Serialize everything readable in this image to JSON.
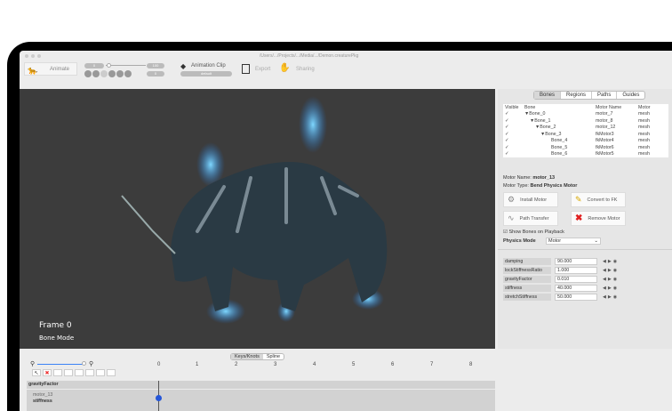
{
  "window": {
    "title": "/Users/.../Projects/.../Media/.../Demon.creaturePkg"
  },
  "toolbar": {
    "mode_label": "Animate",
    "range_start": "0",
    "range_end": "100",
    "frame": "0",
    "clip_label": "Animation Clip",
    "clip_value": "default",
    "export_label": "Export",
    "sharing_label": "Sharing"
  },
  "viewport": {
    "frame_label": "Frame 0",
    "mode_label": "Bone Mode"
  },
  "panel": {
    "tabs": [
      "Bones",
      "Regions",
      "Paths",
      "Guides"
    ],
    "columns": [
      "Visible",
      "Bone",
      "Motor Name",
      "Motor"
    ],
    "rows": [
      [
        "✓",
        "▼Bone_0",
        "motor_7",
        "mesh"
      ],
      [
        "✓",
        "▼Bone_1",
        "motor_8",
        "mesh"
      ],
      [
        "✓",
        "▼Bone_2",
        "motor_12",
        "mesh"
      ],
      [
        "✓",
        "▼Bone_3",
        "fkMotor3",
        "mesh"
      ],
      [
        "✓",
        "Bone_4",
        "fkMotor4",
        "mesh"
      ],
      [
        "✓",
        "Bone_5",
        "fkMotor6",
        "mesh"
      ],
      [
        "✓",
        "Bone_6",
        "fkMotor5",
        "mesh"
      ]
    ],
    "motor_name_label": "Motor Name:",
    "motor_name": "motor_13",
    "motor_type_label": "Motor Type:",
    "motor_type": "Bend Physics Motor",
    "buttons": {
      "install": "Install Motor",
      "convert": "Convert to FK",
      "path": "Path Transfer",
      "remove": "Remove Motor"
    },
    "show_bones": "Show Bones on Playback",
    "physics_mode_label": "Physics Mode",
    "physics_mode": "Motor",
    "props": [
      {
        "name": "damping",
        "value": "90.000"
      },
      {
        "name": "lockStiffnessRatio",
        "value": "1.000"
      },
      {
        "name": "gravityFactor",
        "value": "0.010"
      },
      {
        "name": "stiffness",
        "value": "40.000"
      },
      {
        "name": "stretchStiffness",
        "value": "50.000"
      }
    ]
  },
  "timeline": {
    "tabs": [
      "Keys/Knots",
      "Spline"
    ],
    "ticks": [
      "0",
      "1",
      "2",
      "3",
      "4",
      "5",
      "6",
      "7",
      "8"
    ],
    "tracks": [
      {
        "motor": "",
        "prop": "gravityFactor"
      },
      {
        "motor": "motor_13",
        "prop": "stiffness"
      }
    ]
  }
}
